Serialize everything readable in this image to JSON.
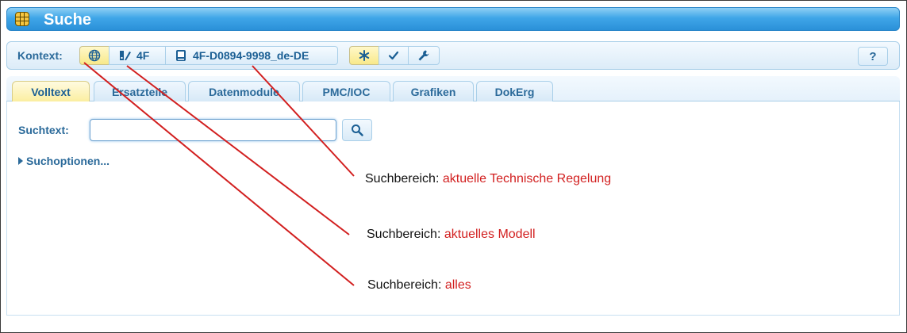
{
  "window": {
    "title": "Suche"
  },
  "toolbar": {
    "context_label": "Kontext:",
    "model_label": "4F",
    "document_label": "4F-D0894-9998_de-DE",
    "help_label": "?"
  },
  "tabs": [
    {
      "label": "Volltext",
      "active": true
    },
    {
      "label": "Ersatzteile"
    },
    {
      "label": "Datenmodule"
    },
    {
      "label": "PMC/IOC"
    },
    {
      "label": "Grafiken"
    },
    {
      "label": "DokErg"
    }
  ],
  "search": {
    "label": "Suchtext:",
    "value": "",
    "options_label": "Suchoptionen..."
  },
  "annotations": [
    {
      "prefix": "Suchbereich: ",
      "text": "aktuelle Technische Regelung"
    },
    {
      "prefix": "Suchbereich: ",
      "text": "aktuelles Modell"
    },
    {
      "prefix": "Suchbereich: ",
      "text": "alles"
    }
  ],
  "colors": {
    "title_bar": "#3fa6e8",
    "label_text": "#2b6a9a",
    "active_tab": "#fbeea0",
    "annotation_highlight": "#d21f1f"
  },
  "icons": [
    "grid-icon",
    "globe-icon",
    "model-icon",
    "book-icon",
    "asterisk-icon",
    "check-icon",
    "wrench-icon",
    "search-icon",
    "caret-right-icon"
  ]
}
